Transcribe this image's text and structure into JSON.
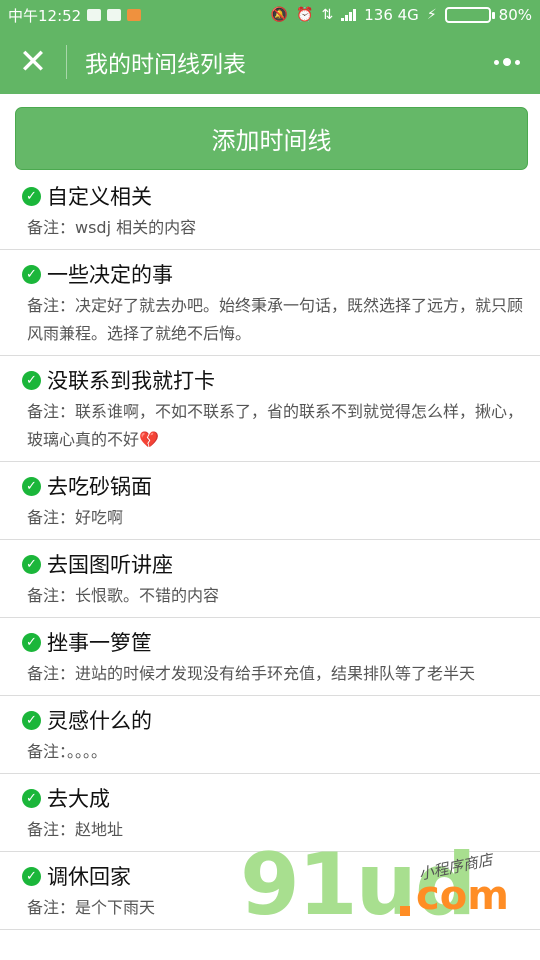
{
  "status": {
    "time": "中午12:52",
    "network": "136 4G",
    "battery_text": "80%",
    "battery_level": 0.8
  },
  "nav": {
    "title": "我的时间线列表",
    "close_icon": "close-icon",
    "more_icon": "more-icon"
  },
  "add_button": {
    "label": "添加时间线"
  },
  "items": [
    {
      "title": "自定义相关",
      "note": "备注：wsdj 相关的内容"
    },
    {
      "title": "一些决定的事",
      "note": "备注：决定好了就去办吧。始终秉承一句话，既然选择了远方，就只顾风雨兼程。选择了就绝不后悔。"
    },
    {
      "title": "没联系到我就打卡",
      "note": "备注：联系谁啊，不如不联系了，省的联系不到就觉得怎么样，揪心，玻璃心真的不好💔"
    },
    {
      "title": "去吃砂锅面",
      "note": "备注：好吃啊"
    },
    {
      "title": "去国图听讲座",
      "note": "备注：长恨歌。不错的内容"
    },
    {
      "title": "挫事一箩筐",
      "note": "备注：进站的时候才发现没有给手环充值，结果排队等了老半天"
    },
    {
      "title": "灵感什么的",
      "note": "备注：。。。。"
    },
    {
      "title": "去大成",
      "note": "备注：赵地址"
    },
    {
      "title": "调休回家",
      "note": "备注：是个下雨天"
    }
  ],
  "watermark": {
    "logo": "91ud",
    "tld": "com",
    "tagline": "小程序商店"
  },
  "colors": {
    "primary": "#62b665",
    "check": "#1bb63a",
    "watermark_green": "#a8df8f",
    "watermark_orange": "#ff8d25"
  }
}
